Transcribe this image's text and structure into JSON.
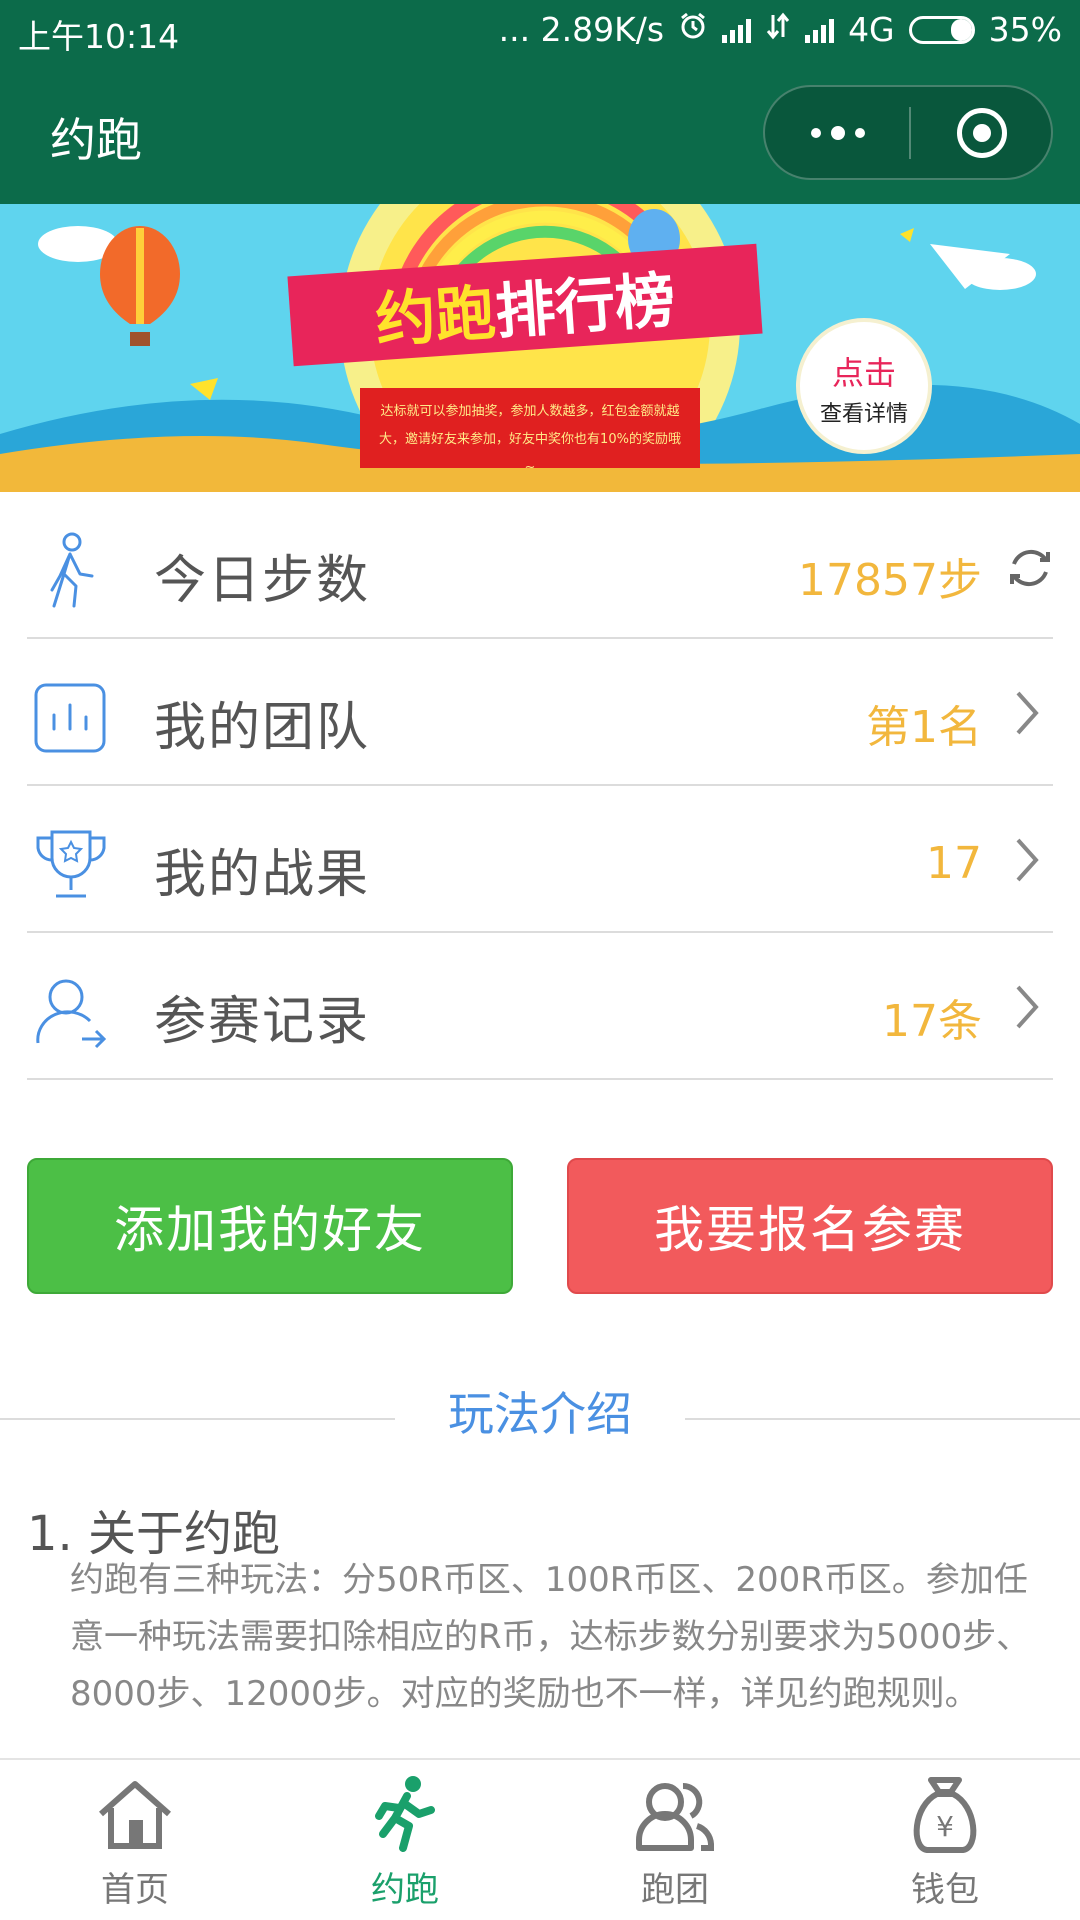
{
  "status_bar": {
    "time": "上午10:14",
    "network_speed": "... 2.89K/s",
    "network_type": "4G",
    "battery": "35%",
    "battery_level": 0.35
  },
  "titlebar": {
    "title": "约跑"
  },
  "banner": {
    "headline_part1": "约跑",
    "headline_part2": "排行榜",
    "subtext": "达标就可以参加抽奖，参加人数越多，红包金额就越大，邀请好友来参加，好友中奖你也有10%的奖励哦~",
    "cta_line1": "点击",
    "cta_line2": "查看详情"
  },
  "stats": [
    {
      "label": "今日步数",
      "value": "17857步",
      "icon": "walking-person-icon"
    },
    {
      "label": "我的团队",
      "value": "第1名",
      "icon": "bar-chart-icon"
    },
    {
      "label": "我的战果",
      "value": "17",
      "icon": "trophy-icon"
    },
    {
      "label": "参赛记录",
      "value": "17条",
      "icon": "user-arrow-icon"
    }
  ],
  "buttons": {
    "add_friend": "添加我的好友",
    "join_race": "我要报名参赛"
  },
  "intro": {
    "heading": "玩法介绍",
    "section1_title": "1. 关于约跑",
    "section1_body": "约跑有三种玩法：分50R币区、100R币区、200R币区。参加任意一种玩法需要扣除相应的R币，达标步数分别要求为5000步、8000步、12000步。对应的奖励也不一样，详见约跑规则。"
  },
  "tabbar": {
    "items": [
      {
        "label": "首页",
        "icon": "home-icon",
        "active": false
      },
      {
        "label": "约跑",
        "icon": "running-icon",
        "active": true
      },
      {
        "label": "跑团",
        "icon": "group-icon",
        "active": false
      },
      {
        "label": "钱包",
        "icon": "money-bag-icon",
        "active": false
      }
    ]
  },
  "colors": {
    "header": "#0c6b4a",
    "accent_value": "#f2b73d",
    "add_button": "#4cbf46",
    "join_button": "#f25a5c",
    "intro_heading": "#4a90e2",
    "tab_active": "#1aa06b"
  }
}
